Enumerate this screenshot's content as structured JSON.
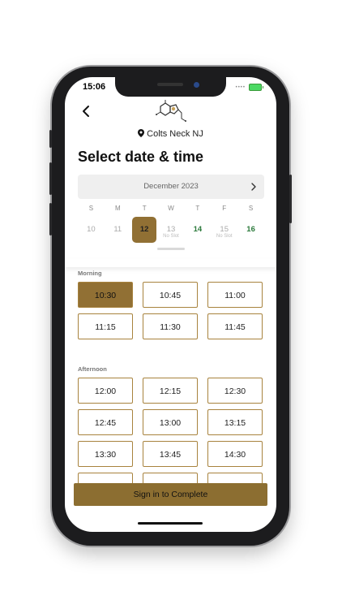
{
  "status_bar": {
    "time": "15:06",
    "signal": "••••"
  },
  "header": {
    "location": "Colts Neck NJ",
    "title": "Select date & time"
  },
  "calendar": {
    "month": "December 2023",
    "weekdays": [
      "S",
      "M",
      "T",
      "W",
      "T",
      "F",
      "S"
    ],
    "days": [
      {
        "num": "10",
        "sub": "",
        "state": "disabled"
      },
      {
        "num": "11",
        "sub": "",
        "state": "disabled"
      },
      {
        "num": "12",
        "sub": "",
        "state": "selected"
      },
      {
        "num": "13",
        "sub": "No Slot",
        "state": "disabled"
      },
      {
        "num": "14",
        "sub": "",
        "state": "available"
      },
      {
        "num": "15",
        "sub": "No Slot",
        "state": "disabled"
      },
      {
        "num": "16",
        "sub": "",
        "state": "available"
      }
    ]
  },
  "morning": {
    "label": "Morning",
    "slots": [
      "10:30",
      "10:45",
      "11:00",
      "11:15",
      "11:30",
      "11:45"
    ],
    "selected": "10:30"
  },
  "afternoon": {
    "label": "Afternoon",
    "slots": [
      "12:00",
      "12:15",
      "12:30",
      "12:45",
      "13:00",
      "13:15",
      "13:30",
      "13:45",
      "14:30",
      "",
      "",
      ""
    ]
  },
  "cta": {
    "label": "Sign in to Complete"
  },
  "colors": {
    "accent": "#917034",
    "slot_border": "#a8833e",
    "available_day": "#2c7a3c"
  },
  "icons": [
    "chevron-left-icon",
    "chevron-right-icon",
    "map-pin-icon",
    "logo-icon"
  ]
}
